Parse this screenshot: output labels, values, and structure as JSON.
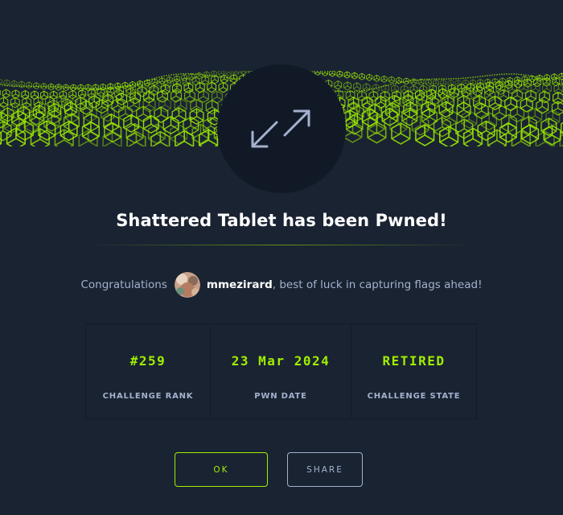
{
  "modal": {
    "title": "Shattered Tablet has been Pwned!",
    "congrats_prefix": "Congratulations",
    "username": "mmezirard",
    "congrats_suffix": ", best of luck in capturing flags ahead!"
  },
  "stats": [
    {
      "value": "#259",
      "label": "CHALLENGE RANK"
    },
    {
      "value": "23 Mar 2024",
      "label": "PWN DATE"
    },
    {
      "value": "RETIRED",
      "label": "CHALLENGE STATE"
    }
  ],
  "buttons": {
    "ok_label": "OK",
    "share_label": "SHARE"
  },
  "icons": {
    "center": "expand-arrows-icon",
    "banner": "green-cube-grid"
  },
  "colors": {
    "background": "#1a2332",
    "accent": "#9fef00",
    "muted": "#a4b1cd",
    "circle": "#111927"
  }
}
